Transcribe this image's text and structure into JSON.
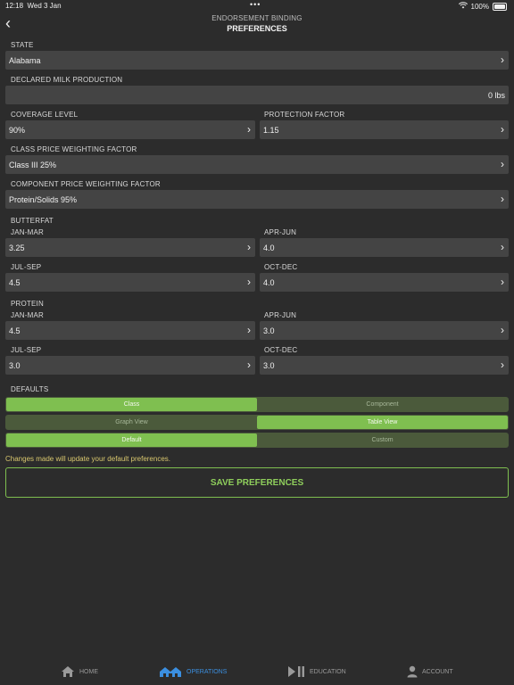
{
  "status": {
    "time": "12:18",
    "date": "Wed 3 Jan",
    "dots": "•••",
    "battery": "100%"
  },
  "nav": {
    "back_icon": "chevron-left-icon",
    "subtitle": "ENDORSEMENT BINDING",
    "title": "PREFERENCES"
  },
  "state": {
    "label": "STATE",
    "value": "Alabama"
  },
  "milk": {
    "label": "DECLARED MILK PRODUCTION",
    "value": "0 lbs"
  },
  "coverage": {
    "label": "COVERAGE LEVEL",
    "value": "90%"
  },
  "protection": {
    "label": "PROTECTION FACTOR",
    "value": "1.15"
  },
  "class_price": {
    "label": "CLASS PRICE WEIGHTING FACTOR",
    "value": "Class III 25%"
  },
  "component_price": {
    "label": "COMPONENT PRICE WEIGHTING FACTOR",
    "value": "Protein/Solids 95%"
  },
  "butterfat": {
    "label": "BUTTERFAT",
    "jan_mar": {
      "label": "JAN-MAR",
      "value": "3.25"
    },
    "apr_jun": {
      "label": "APR-JUN",
      "value": "4.0"
    },
    "jul_sep": {
      "label": "JUL-SEP",
      "value": "4.5"
    },
    "oct_dec": {
      "label": "OCT-DEC",
      "value": "4.0"
    }
  },
  "protein": {
    "label": "PROTEIN",
    "jan_mar": {
      "label": "JAN-MAR",
      "value": "4.5"
    },
    "apr_jun": {
      "label": "APR-JUN",
      "value": "3.0"
    },
    "jul_sep": {
      "label": "JUL-SEP",
      "value": "3.0"
    },
    "oct_dec": {
      "label": "OCT-DEC",
      "value": "3.0"
    }
  },
  "defaults": {
    "label": "DEFAULTS",
    "seg1": {
      "left": "Class",
      "right": "Component",
      "selected": "left"
    },
    "seg2": {
      "left": "Graph View",
      "right": "Table View",
      "selected": "right"
    },
    "seg3": {
      "left": "Default",
      "right": "Custom",
      "selected": "left"
    }
  },
  "note": "Changes made will update your default preferences.",
  "save_label": "SAVE PREFERENCES",
  "tabs": [
    {
      "label": "HOME",
      "icon": "home-icon",
      "active": false
    },
    {
      "label": "OPERATIONS",
      "icon": "operations-icon",
      "active": true
    },
    {
      "label": "EDUCATION",
      "icon": "play-pause-icon",
      "active": false
    },
    {
      "label": "ACCOUNT",
      "icon": "person-icon",
      "active": false
    }
  ],
  "colors": {
    "accent_green": "#7fbf50",
    "active_tab_blue": "#3b8fe0",
    "note_yellow": "#d9c76e"
  }
}
